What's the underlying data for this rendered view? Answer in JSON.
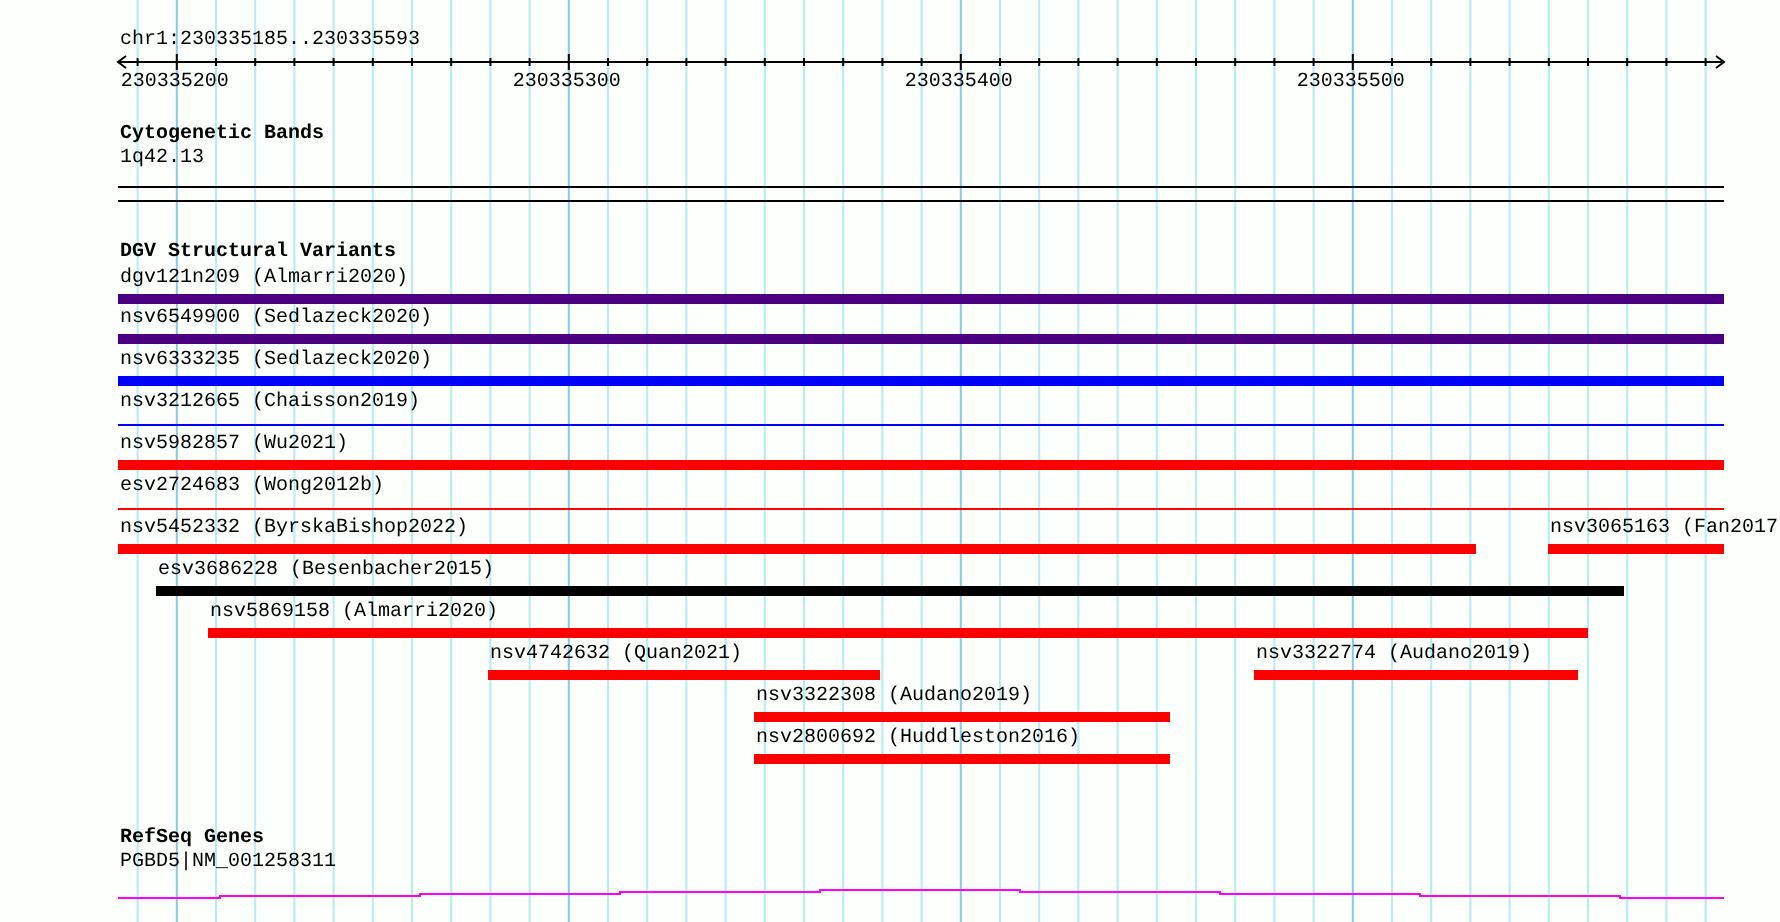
{
  "location": "chr1:230335185..230335593",
  "ruler": {
    "ticks": [
      "230335200",
      "230335300",
      "230335400",
      "230335500"
    ]
  },
  "tracks": [
    {
      "kind": "bands",
      "title": "Cytogenetic Bands",
      "features": [
        {
          "label": "1q42.13"
        }
      ]
    },
    {
      "kind": "variants",
      "title": "DGV Structural Variants",
      "features": [
        {
          "label": "dgv121n209 (Almarri2020)",
          "color": "#4b0082",
          "kind": "thick"
        },
        {
          "label": "nsv6549900 (Sedlazeck2020)",
          "color": "#4b0082",
          "kind": "thick"
        },
        {
          "label": "nsv6333235 (Sedlazeck2020)",
          "color": "#0000ff",
          "kind": "thick"
        },
        {
          "label": "nsv3212665 (Chaisson2019)",
          "color": "#0000ff",
          "kind": "thin"
        },
        {
          "label": "nsv5982857 (Wu2021)",
          "color": "#ff0000",
          "kind": "thick"
        },
        {
          "label": "esv2724683 (Wong2012b)",
          "color": "#ff0000",
          "kind": "thin"
        },
        {
          "label": "nsv5452332 (ByrskaBishop2022)",
          "color": "#ff0000",
          "kind": "thick"
        },
        {
          "label": "nsv3065163 (Fan2017",
          "color": "#ff0000",
          "kind": "thick"
        },
        {
          "label": "esv3686228 (Besenbacher2015)",
          "color": "#000000",
          "kind": "thick"
        },
        {
          "label": "nsv5869158 (Almarri2020)",
          "color": "#ff0000",
          "kind": "thick"
        },
        {
          "label": "nsv4742632 (Quan2021)",
          "color": "#ff0000",
          "kind": "thick"
        },
        {
          "label": "nsv3322774 (Audano2019)",
          "color": "#ff0000",
          "kind": "thick"
        },
        {
          "label": "nsv3322308 (Audano2019)",
          "color": "#ff0000",
          "kind": "thick"
        },
        {
          "label": "nsv2800692 (Huddleston2016)",
          "color": "#ff0000",
          "kind": "thick"
        }
      ]
    },
    {
      "kind": "genes",
      "title": "RefSeq Genes",
      "features": [
        {
          "label": "PGBD5|NM_001258311"
        }
      ]
    }
  ]
}
